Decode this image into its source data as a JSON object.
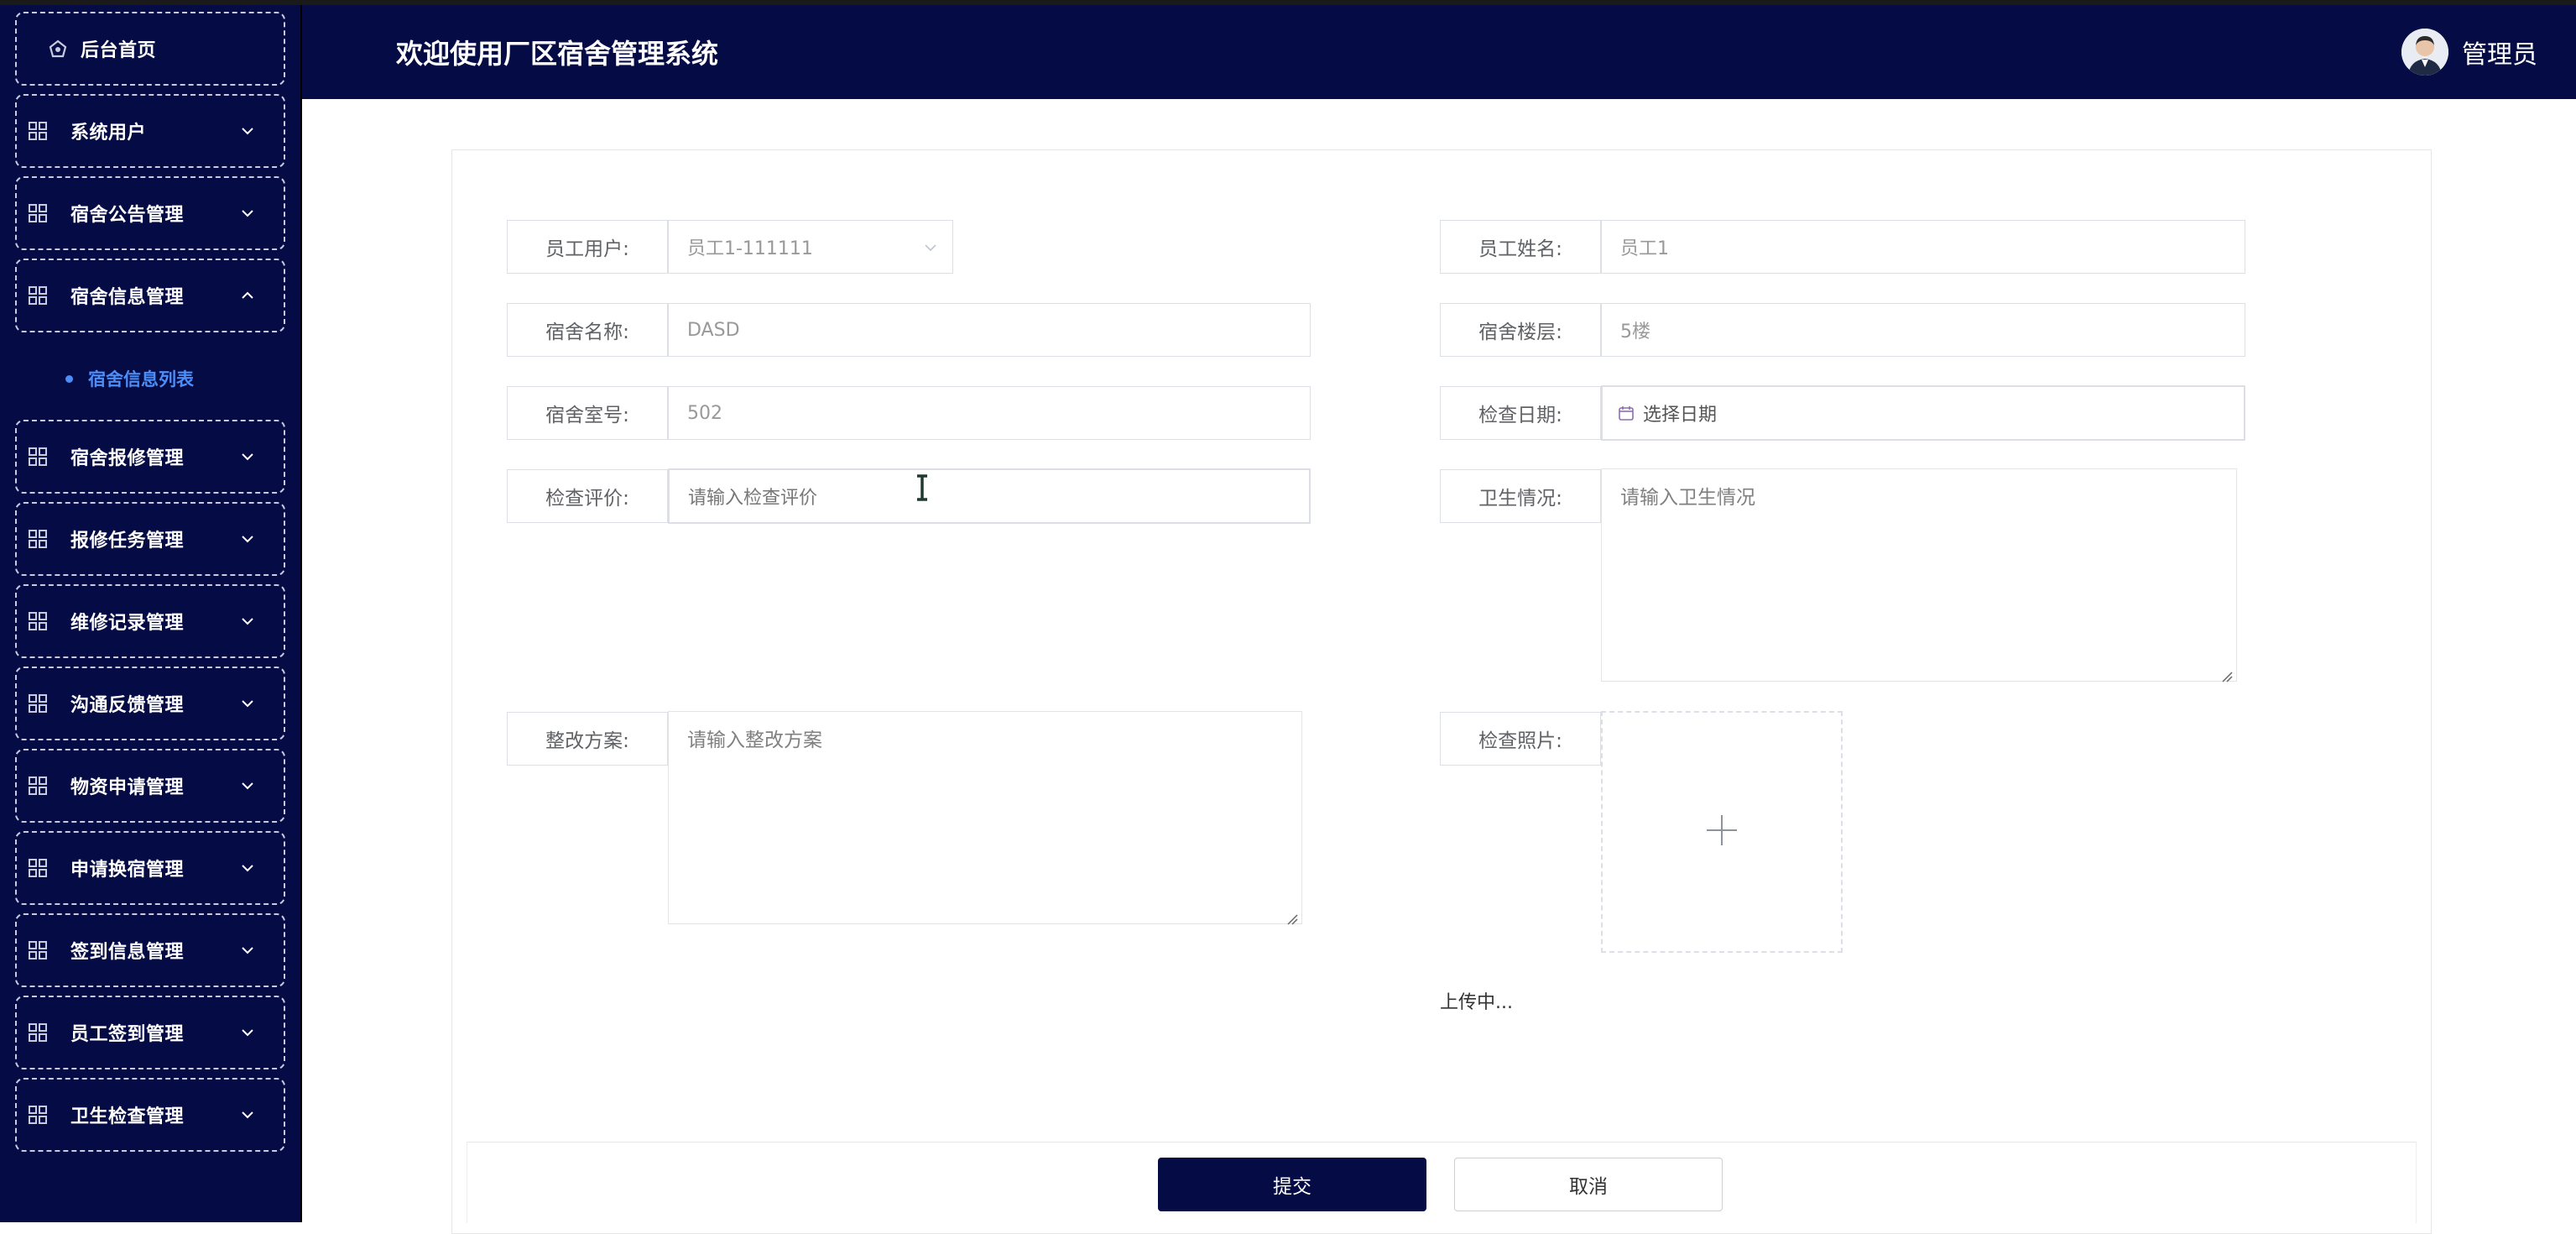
{
  "header": {
    "title": "欢迎使用厂区宿舍管理系统",
    "user_name": "管理员"
  },
  "sidebar": {
    "home": "后台首页",
    "items": [
      {
        "label": "系统用户"
      },
      {
        "label": "宿舍公告管理"
      },
      {
        "label": "宿舍信息管理",
        "expanded": true
      },
      {
        "label": "宿舍报修管理"
      },
      {
        "label": "报修任务管理"
      },
      {
        "label": "维修记录管理"
      },
      {
        "label": "沟通反馈管理"
      },
      {
        "label": "物资申请管理"
      },
      {
        "label": "申请换宿管理"
      },
      {
        "label": "签到信息管理"
      },
      {
        "label": "员工签到管理"
      },
      {
        "label": "卫生检查管理"
      }
    ],
    "active_sub": "宿舍信息列表"
  },
  "form": {
    "employee_user_label": "员工用户:",
    "employee_user_value": "员工1-111111",
    "employee_name_label": "员工姓名:",
    "employee_name_value": "员工1",
    "dorm_name_label": "宿舍名称:",
    "dorm_name_value": "DASD",
    "dorm_floor_label": "宿舍楼层:",
    "dorm_floor_value": "5楼",
    "dorm_room_label": "宿舍室号:",
    "dorm_room_value": "502",
    "check_date_label": "检查日期:",
    "check_date_placeholder": "选择日期",
    "evaluation_label": "检查评价:",
    "evaluation_placeholder": "请输入检查评价",
    "hygiene_label": "卫生情况:",
    "hygiene_placeholder": "请输入卫生情况",
    "rectify_label": "整改方案:",
    "rectify_placeholder": "请输入整改方案",
    "photo_label": "检查照片:",
    "upload_status": "上传中..."
  },
  "buttons": {
    "submit": "提交",
    "cancel": "取消"
  },
  "colors": {
    "nav_bg": "#050b45",
    "active_link": "#4d8df7"
  }
}
